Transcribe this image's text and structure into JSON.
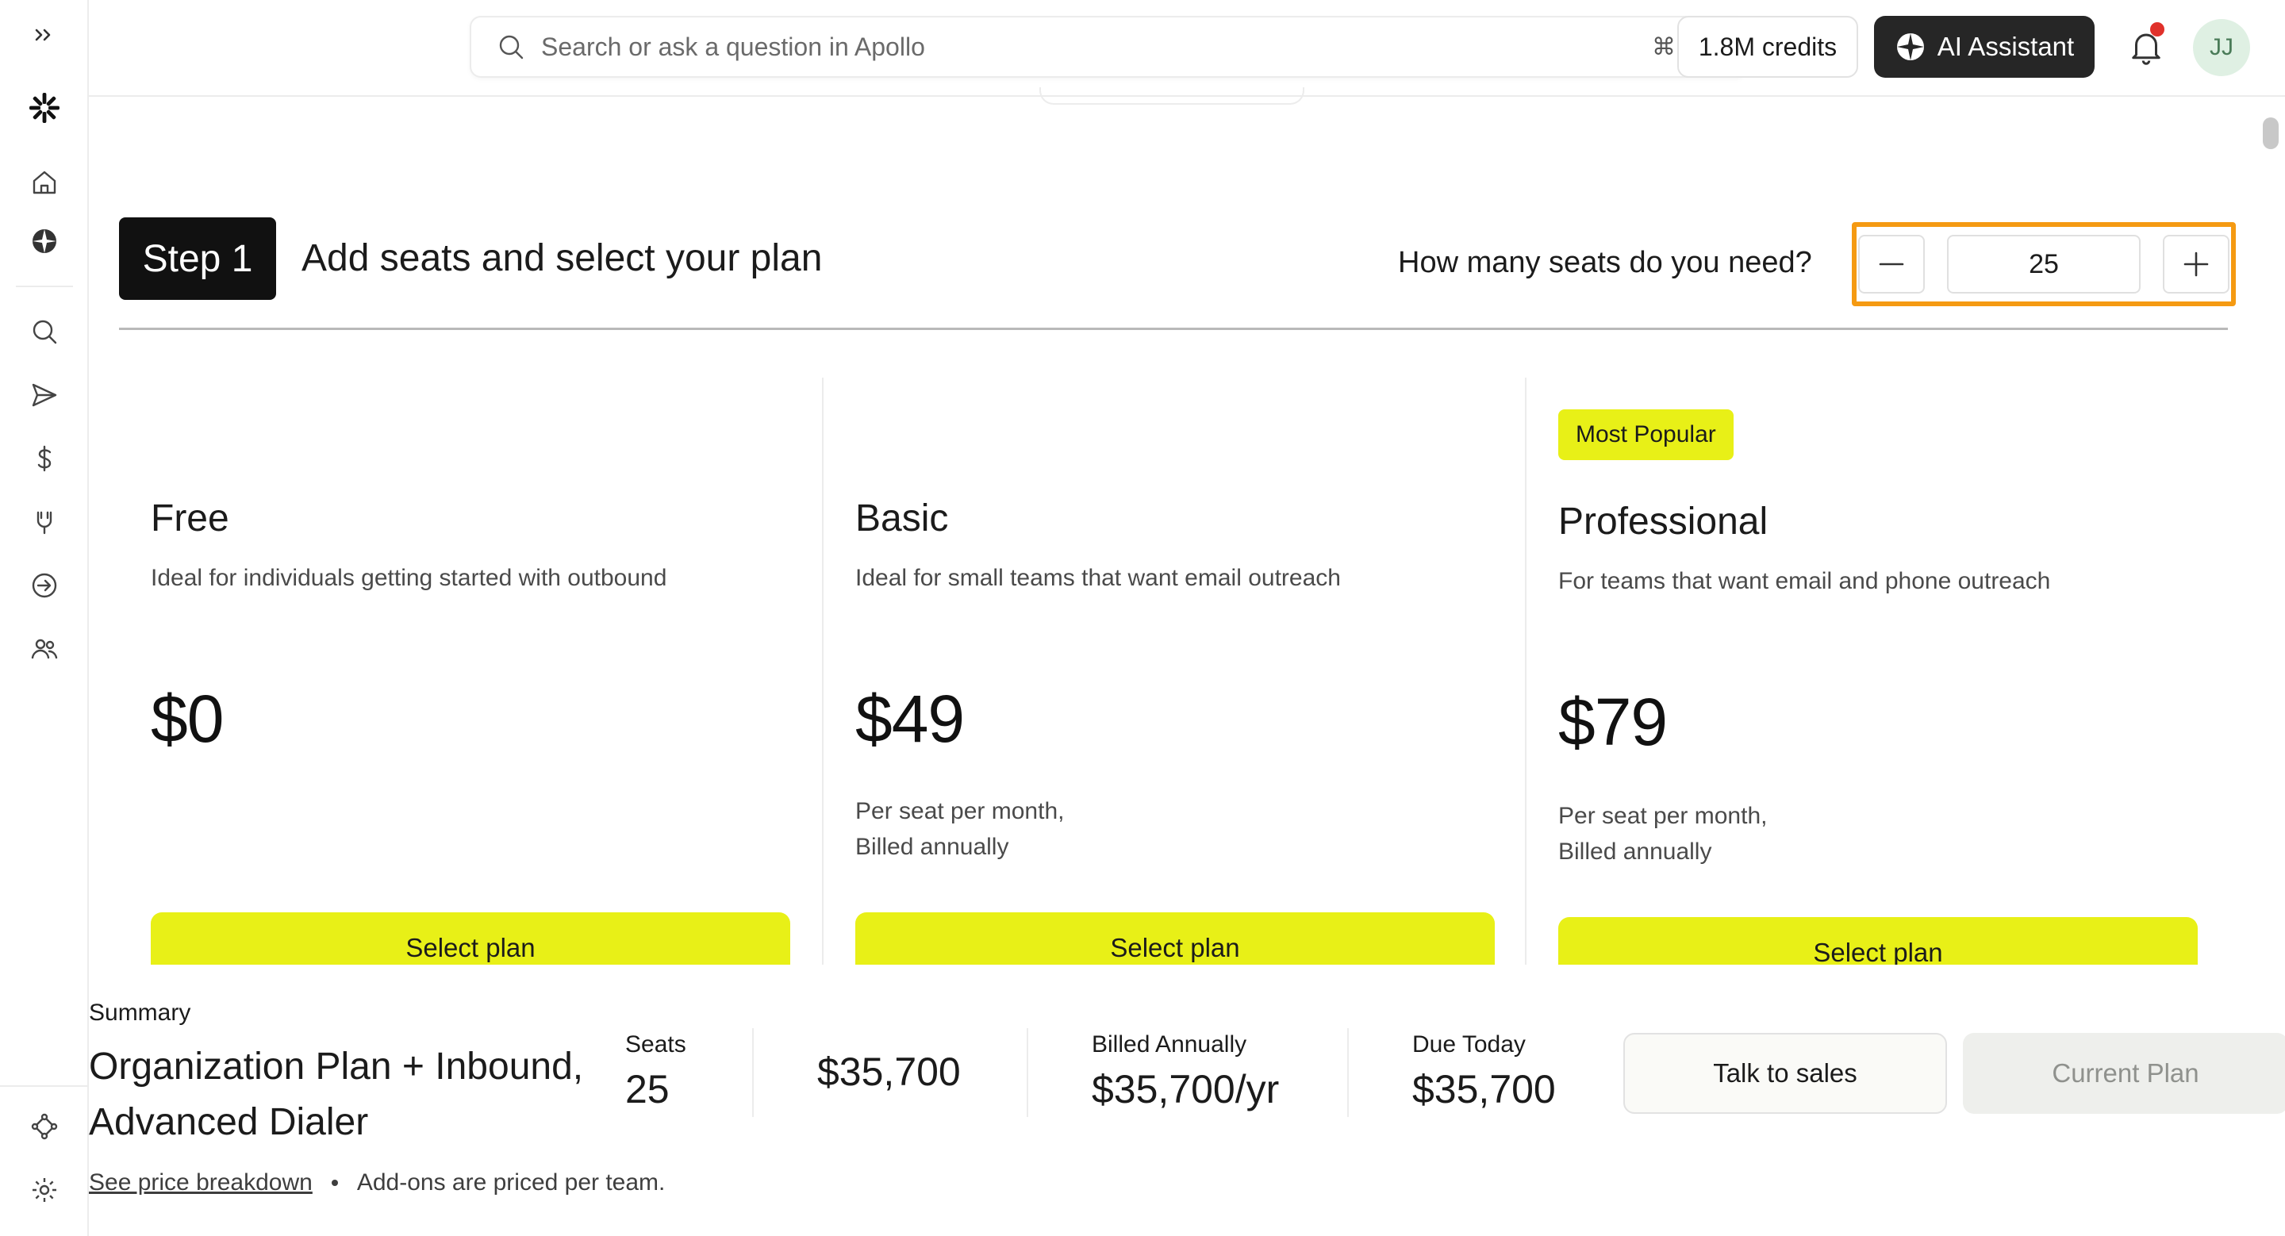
{
  "sidebar": {
    "expand_icon": "double-chevron-right-icon",
    "logo_icon": "apollo-asterisk-logo-icon",
    "items": [
      {
        "name": "home",
        "icon": "home-icon"
      },
      {
        "name": "ai",
        "icon": "apollo-ai-icon"
      },
      {
        "name": "search",
        "icon": "search-icon"
      },
      {
        "name": "engage",
        "icon": "send-icon"
      },
      {
        "name": "deals",
        "icon": "dollar-icon"
      },
      {
        "name": "tasks",
        "icon": "plug-icon"
      },
      {
        "name": "inbound",
        "icon": "sign-in-arrow-icon"
      },
      {
        "name": "people",
        "icon": "users-icon"
      }
    ],
    "bottom_items": [
      {
        "name": "workflows",
        "icon": "workflow-icon"
      },
      {
        "name": "settings",
        "icon": "gear-icon"
      }
    ]
  },
  "topbar": {
    "search_placeholder": "Search or ask a question in Apollo",
    "search_shortcut": "⌘K",
    "credits_label": "1.8M credits",
    "ai_button_label": "AI Assistant",
    "avatar_initials": "JJ",
    "has_notification": true
  },
  "step": {
    "badge": "Step 1",
    "title": "Add seats and select your plan",
    "seats_question": "How many seats do you need?",
    "seats_value": "25"
  },
  "plans": [
    {
      "name": "Free",
      "badge": "",
      "description": "Ideal for individuals getting started with outbound",
      "price": "$0",
      "note_line1": "",
      "note_line2": "",
      "button": "Select plan"
    },
    {
      "name": "Basic",
      "badge": "",
      "description": "Ideal for small teams that want email outreach",
      "price": "$49",
      "note_line1": "Per seat per month,",
      "note_line2": "Billed annually",
      "button": "Select plan"
    },
    {
      "name": "Professional",
      "badge": "Most Popular",
      "description": "For teams that want email and phone outreach",
      "price": "$79",
      "note_line1": "Per seat per month,",
      "note_line2": "Billed annually",
      "button": "Select plan"
    }
  ],
  "summary": {
    "label": "Summary",
    "plan_line1": "Organization Plan + Inbound,",
    "plan_line2": "Advanced Dialer",
    "seats_label": "Seats",
    "seats_value": "25",
    "subtotal_value": "$35,700",
    "billed_label": "Billed Annually",
    "billed_value": "$35,700/yr",
    "due_label": "Due Today",
    "due_value": "$35,700",
    "talk_button": "Talk to sales",
    "current_button": "Current Plan",
    "breakdown_link": "See price breakdown",
    "addons_note": "Add-ons are priced per team."
  },
  "colors": {
    "accent_yellow": "#e8f017",
    "highlight_orange": "#f59a12",
    "dark_button": "#262626",
    "notification_dot": "#e0302a"
  }
}
